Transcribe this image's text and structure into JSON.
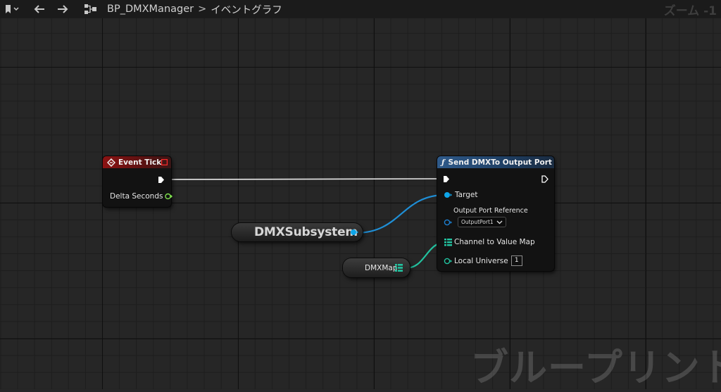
{
  "toolbar": {
    "bookmark_icon": "bookmark-icon",
    "back_icon": "arrow-left-icon",
    "forward_icon": "arrow-right-icon",
    "graph_icon": "blueprint-graph-icon",
    "blueprint_name": "BP_DMXManager",
    "separator": ">",
    "graph_name": "イベントグラフ",
    "zoom_label": "ズーム -1"
  },
  "nodes": {
    "event_tick": {
      "title": "Event Tick",
      "pin_delta": "Delta Seconds"
    },
    "send_dmx": {
      "title": "Send DMXTo Output Port",
      "pin_target": "Target",
      "pin_output_port": "Output Port Reference",
      "output_port_value": "OutputPort1",
      "pin_channel_map": "Channel to Value Map",
      "pin_local_universe": "Local Universe",
      "local_universe_value": "1"
    },
    "dmx_subsystem": {
      "label": "DMXSubsystem"
    },
    "dmx_map": {
      "label": "DMXMap"
    }
  },
  "watermark": "ブループリント",
  "colors": {
    "exec": "#ffffff",
    "object_pin": "#0ea5e9",
    "struct_pin": "#22c3a0",
    "float_pin": "#7ee04d",
    "event_header": "#8b1313",
    "function_header": "#2f5a8a"
  }
}
